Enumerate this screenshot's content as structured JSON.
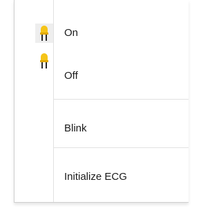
{
  "colors": {
    "led_yellow": "#f5c418",
    "led_legs": "#2a2a2a",
    "text": "#1a1a1a",
    "separator": "#e1e1e1"
  },
  "menu": {
    "items": [
      {
        "label": "On",
        "icon": "led-on-icon"
      },
      {
        "label": "Off",
        "icon": "led-off-icon"
      },
      {
        "label": "Blink"
      },
      {
        "label": "Initialize ECG"
      }
    ]
  }
}
